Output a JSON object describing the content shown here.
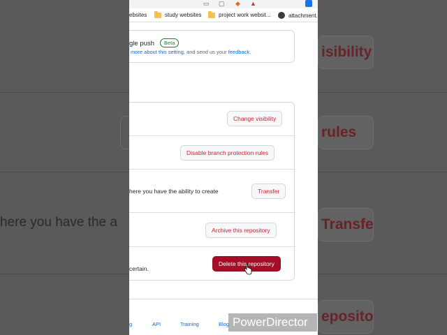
{
  "bookmarks": [
    {
      "label": "ebsites",
      "icon": "folder-icon"
    },
    {
      "label": "study websites",
      "icon": "folder-icon"
    },
    {
      "label": "project work websit...",
      "icon": "folder-icon"
    },
    {
      "label": "attachment...",
      "icon": "globe-icon"
    }
  ],
  "push_setting": {
    "title": "gle push",
    "badge": "Beta",
    "desc_link1": "more about this setting",
    "desc_mid": ", and send us your ",
    "desc_link2": "feedback",
    "desc_end": "."
  },
  "danger_zone": {
    "change_visibility": "Change visibility",
    "disable_branch_protection": "Disable branch protection rules",
    "transfer_text": "here you have the ability to create",
    "transfer_button": "Transfer",
    "archive_button": "Archive this repository",
    "delete_text": "certain.",
    "delete_button": "Delete this repository"
  },
  "footer": {
    "links": [
      "g",
      "API",
      "Training",
      "Blog"
    ]
  },
  "background_zoom": {
    "visibility": "isibility",
    "rules": "rules",
    "transfer_text": "here you have the a",
    "transfer": "Transfer",
    "repository": "epository"
  },
  "watermark": "PowerDirector",
  "colors": {
    "danger_red": "#cf222e",
    "danger_fill": "#a40e26",
    "beta_green": "#1a7f37",
    "link_blue": "#0969da"
  }
}
